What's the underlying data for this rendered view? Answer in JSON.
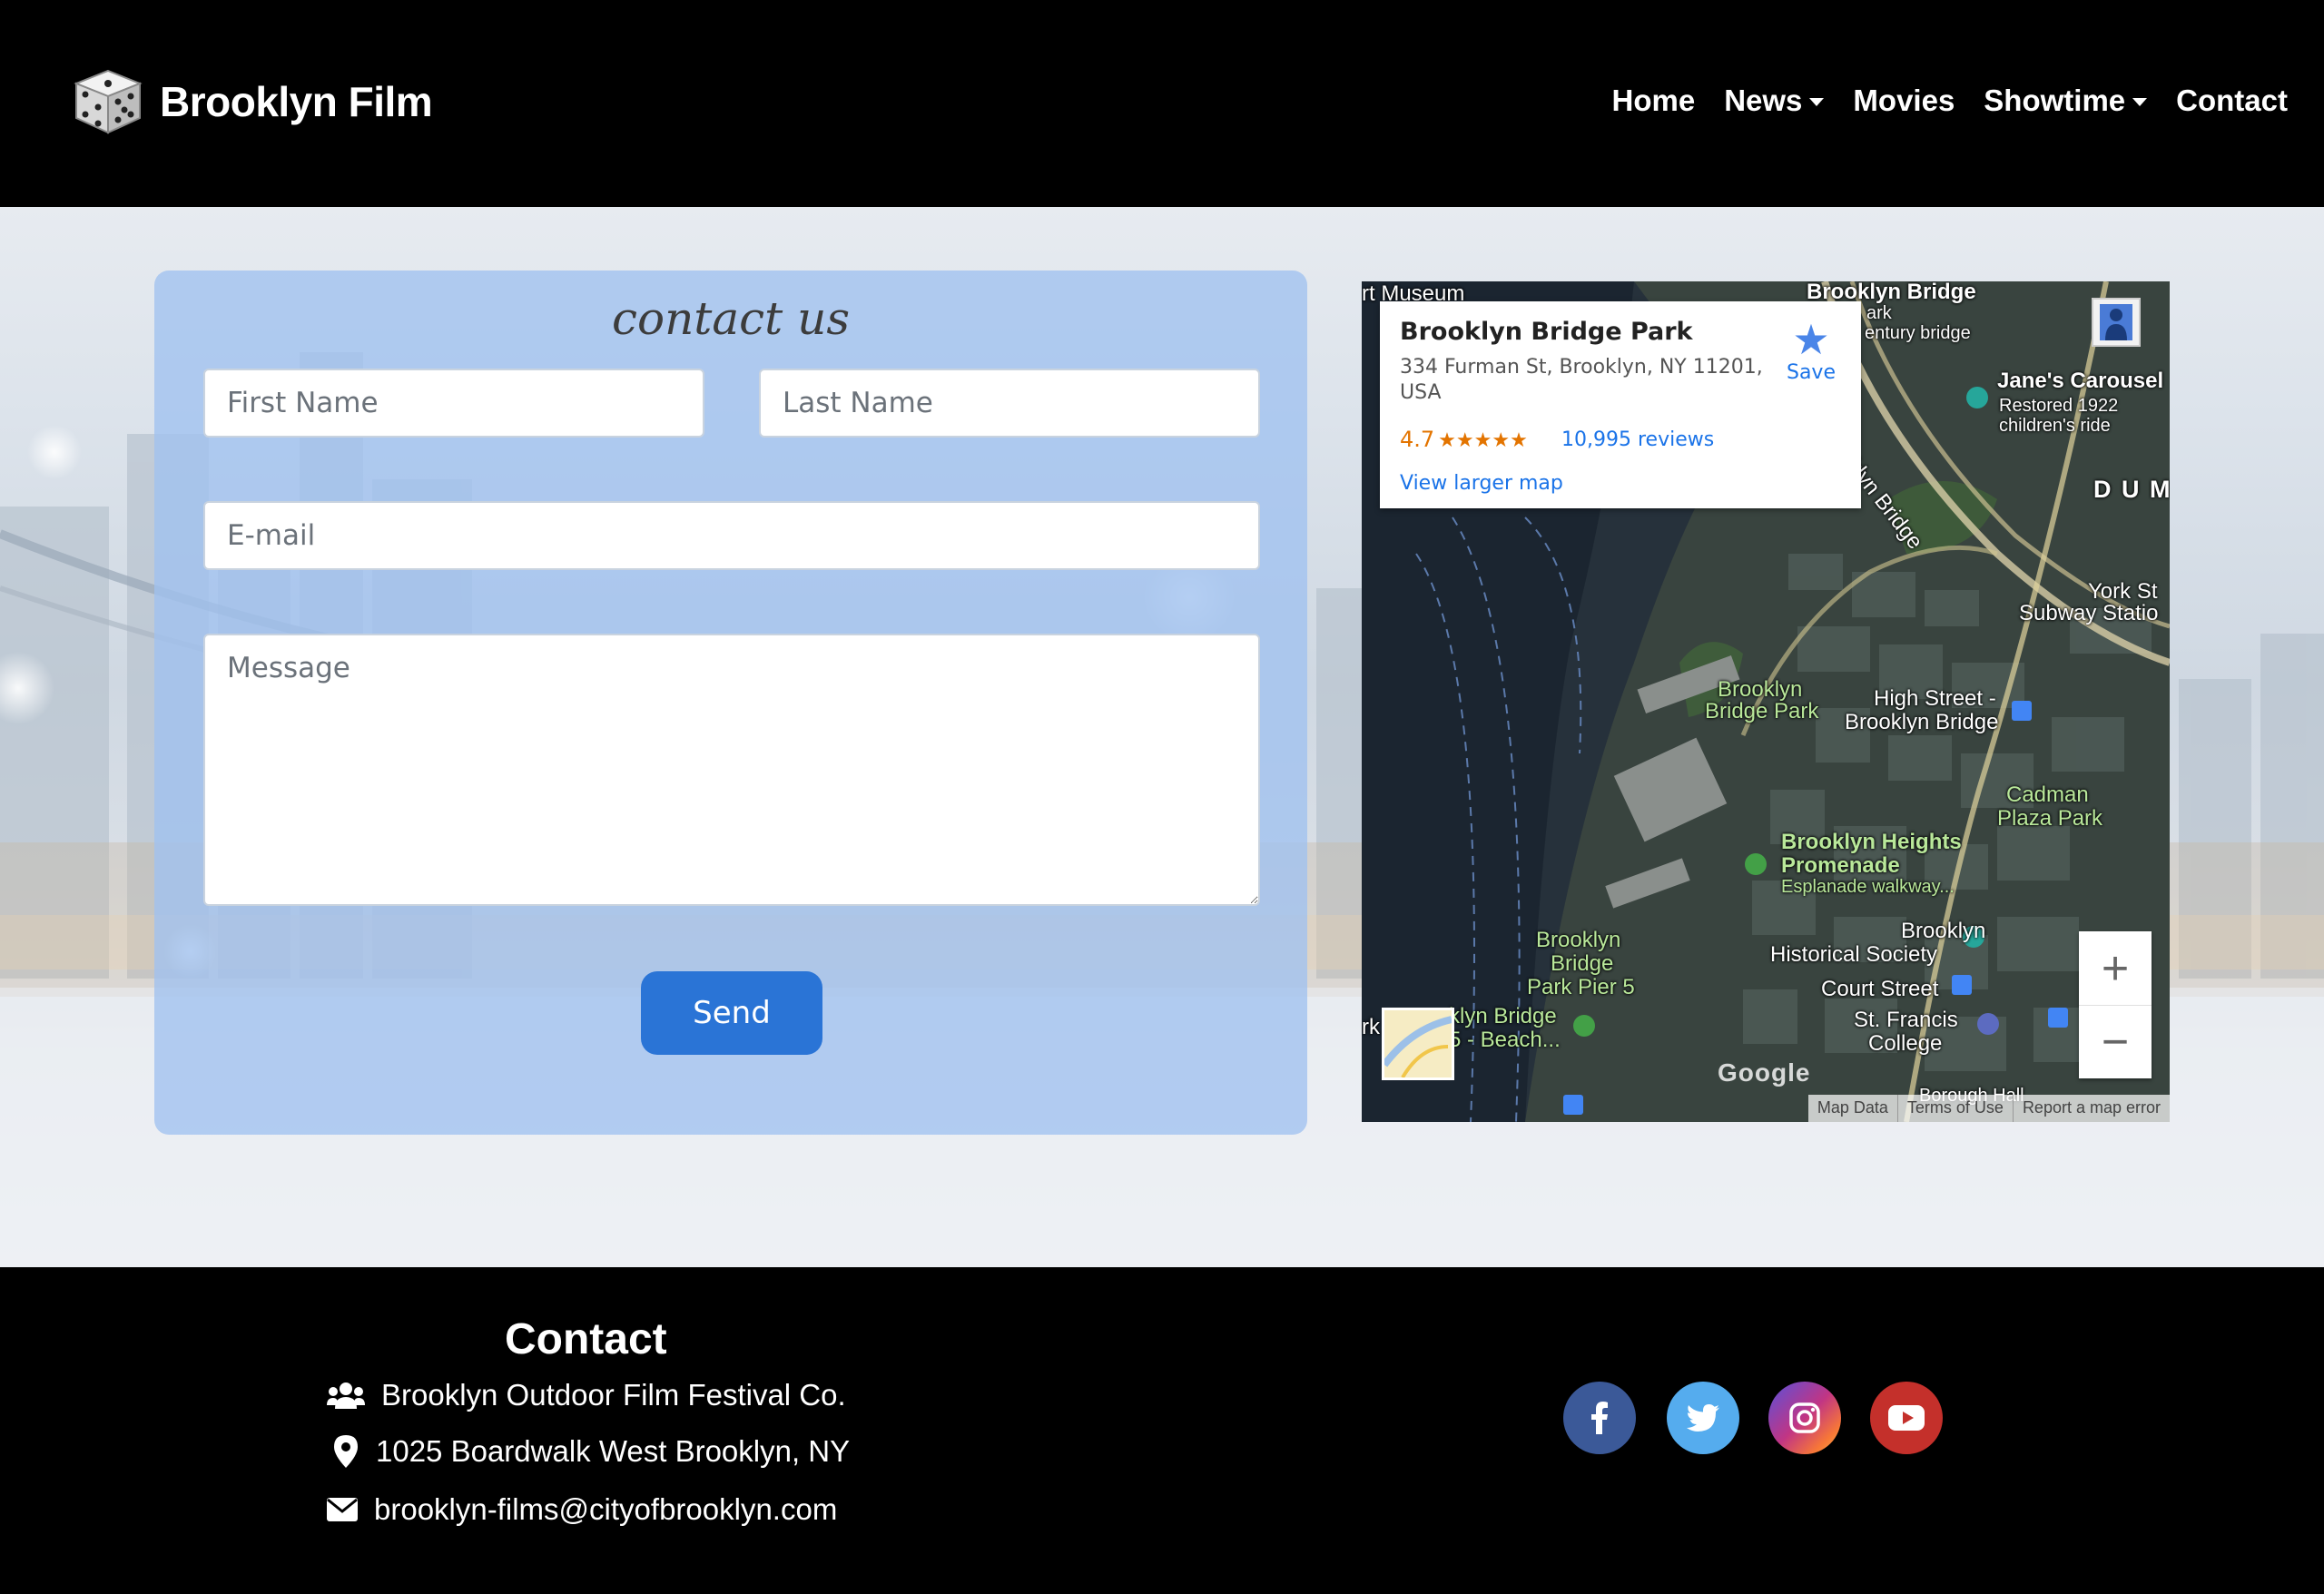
{
  "brand": {
    "name": "Brooklyn Film",
    "logo_icon": "dice-icon"
  },
  "nav": {
    "home": "Home",
    "news": "News",
    "movies": "Movies",
    "showtime": "Showtime",
    "contact": "Contact"
  },
  "form": {
    "title": "contact us",
    "first_name_placeholder": "First Name",
    "last_name_placeholder": "Last Name",
    "email_placeholder": "E-mail",
    "message_placeholder": "Message",
    "send_label": "Send"
  },
  "map": {
    "place_name": "Brooklyn Bridge Park",
    "address": "334 Furman St, Brooklyn, NY 11201, USA",
    "rating": "4.7",
    "stars": "★★★★★",
    "reviews": "10,995 reviews",
    "view_larger": "View larger map",
    "save_label": "Save",
    "labels": {
      "museum": "rt Museum",
      "brooklyn_bridge": "Brooklyn Bridge",
      "park_century": "ark",
      "century_bridge": "entury bridge",
      "janes_carousel": "Jane's Carousel",
      "carousel_1": "Restored 1922",
      "carousel_2": "children's ride",
      "dumbo": "D U M",
      "bridge_road": "klyn Bridge",
      "york_st": "York St",
      "subway_station": "Subway Statio",
      "bbp_1": "Brooklyn",
      "bbp_2": "Bridge Park",
      "high_street_1": "High Street -",
      "high_street_2": "Brooklyn Bridge",
      "cadman_1": "Cadman",
      "cadman_2": "Plaza Park",
      "promenade_1": "Brooklyn Heights",
      "promenade_2": "Promenade",
      "promenade_3": "Esplanade walkway...",
      "pier5_1": "Brooklyn",
      "pier5_2": "Bridge",
      "pier5_3": "Park Pier 5",
      "hist_1": "Brooklyn",
      "hist_2": "Historical Society",
      "court_st": "Court Street",
      "st_francis_1": "St. Francis",
      "st_francis_2": "College",
      "beach_1": "klyn Bridge",
      "beach_2": "5 - Beach...",
      "rk": "rk",
      "borough_hall": "Borough Hall",
      "google": "Google"
    },
    "attribution": [
      "Map Data",
      "Terms of Use",
      "Report a map error"
    ],
    "zoom_in": "+",
    "zoom_out": "−"
  },
  "footer": {
    "title": "Contact",
    "company": "Brooklyn Outdoor Film Festival Co.",
    "address": "1025 Boardwalk West Brooklyn, NY",
    "email": "brooklyn-films@cityofbrooklyn.com",
    "social": [
      {
        "name": "facebook",
        "icon": "facebook-icon",
        "color": "#3b5998"
      },
      {
        "name": "twitter",
        "icon": "twitter-icon",
        "color": "#55acee"
      },
      {
        "name": "instagram",
        "icon": "instagram-icon",
        "color": "#c13584"
      },
      {
        "name": "youtube",
        "icon": "youtube-icon",
        "color": "#c4302b"
      }
    ]
  },
  "colors": {
    "accent_button": "#2a74d6",
    "card_bg": "#a0c1f0",
    "map_link": "#1a73e8"
  }
}
